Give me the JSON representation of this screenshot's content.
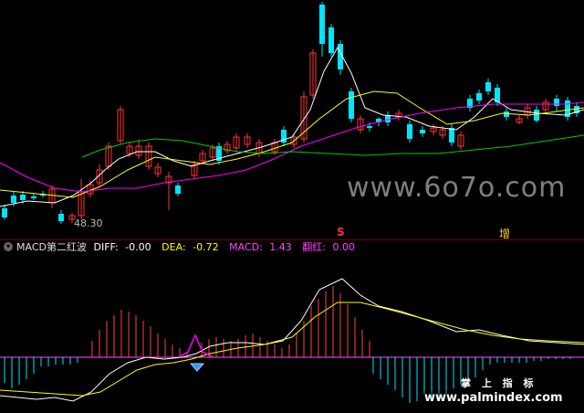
{
  "watermark": "www.6o7o.com",
  "price": {
    "low_label": "48.30",
    "signal_sell": "S",
    "signal_add": "增"
  },
  "indicator": {
    "name": "MACD第二红波",
    "diff_label": "DIFF: ",
    "diff_value": "-0.00",
    "dea_label": "DEA: ",
    "dea_value": "-0.72",
    "macd_label": "MACD: ",
    "macd_value": "1.43",
    "fanhong_label": "翻红: ",
    "fanhong_value": "0.00"
  },
  "colors": {
    "up": "#ff3333",
    "down": "#00e5ff",
    "diff": "#ffffff",
    "dea": "#ffff00",
    "macd_pos": "#ff4444",
    "macd_neg": "#00e5ff",
    "fanhong": "#ff00ff",
    "ma_short": "#ffffff",
    "ma_mid": "#ffff00",
    "ma_long": "#ff00ff",
    "ma_xlong": "#00cc00"
  },
  "footer_brand": "掌 上 指 标",
  "footer_url": "www.palmindex.com"
}
